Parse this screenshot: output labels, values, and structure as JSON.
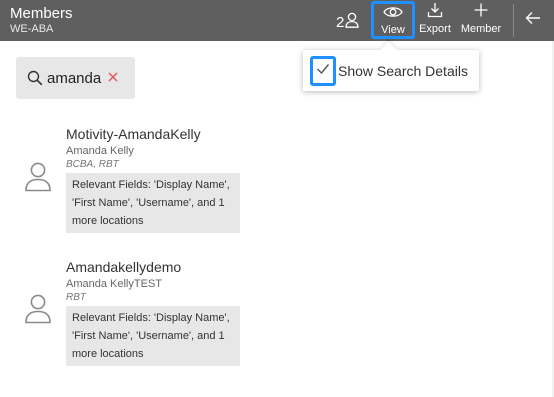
{
  "header": {
    "title": "Members",
    "subtitle": "WE-ABA",
    "count": "2",
    "view_label": "View",
    "export_label": "Export",
    "member_label": "Member",
    "bg_color": "#5f5f5f"
  },
  "view_menu": {
    "show_search_details_label": "Show Search Details",
    "show_search_details_checked": true
  },
  "search": {
    "value": "amanda"
  },
  "results": [
    {
      "display_name": "Motivity-AmandaKelly",
      "full_name": "Amanda Kelly",
      "credentials": "BCBA, RBT",
      "relevant_fields": "Relevant Fields: 'Display Name', 'First Name', 'Username', and 1 more locations"
    },
    {
      "display_name": "Amandakellydemo",
      "full_name": "Amanda KellyTEST",
      "credentials": "RBT",
      "relevant_fields": "Relevant Fields: 'Display Name', 'First Name', 'Username', and 1 more locations"
    }
  ],
  "colors": {
    "highlight": "#1e90ff",
    "clear_icon": "#e05555",
    "chip_bg": "#e7e7e7"
  },
  "icons": {
    "member_count": "person-icon",
    "view": "eye-icon",
    "export": "download-icon",
    "member": "plus-icon",
    "back": "arrow-left-icon",
    "check": "check-icon",
    "search": "search-icon",
    "clear": "close-icon",
    "avatar": "person-icon"
  }
}
